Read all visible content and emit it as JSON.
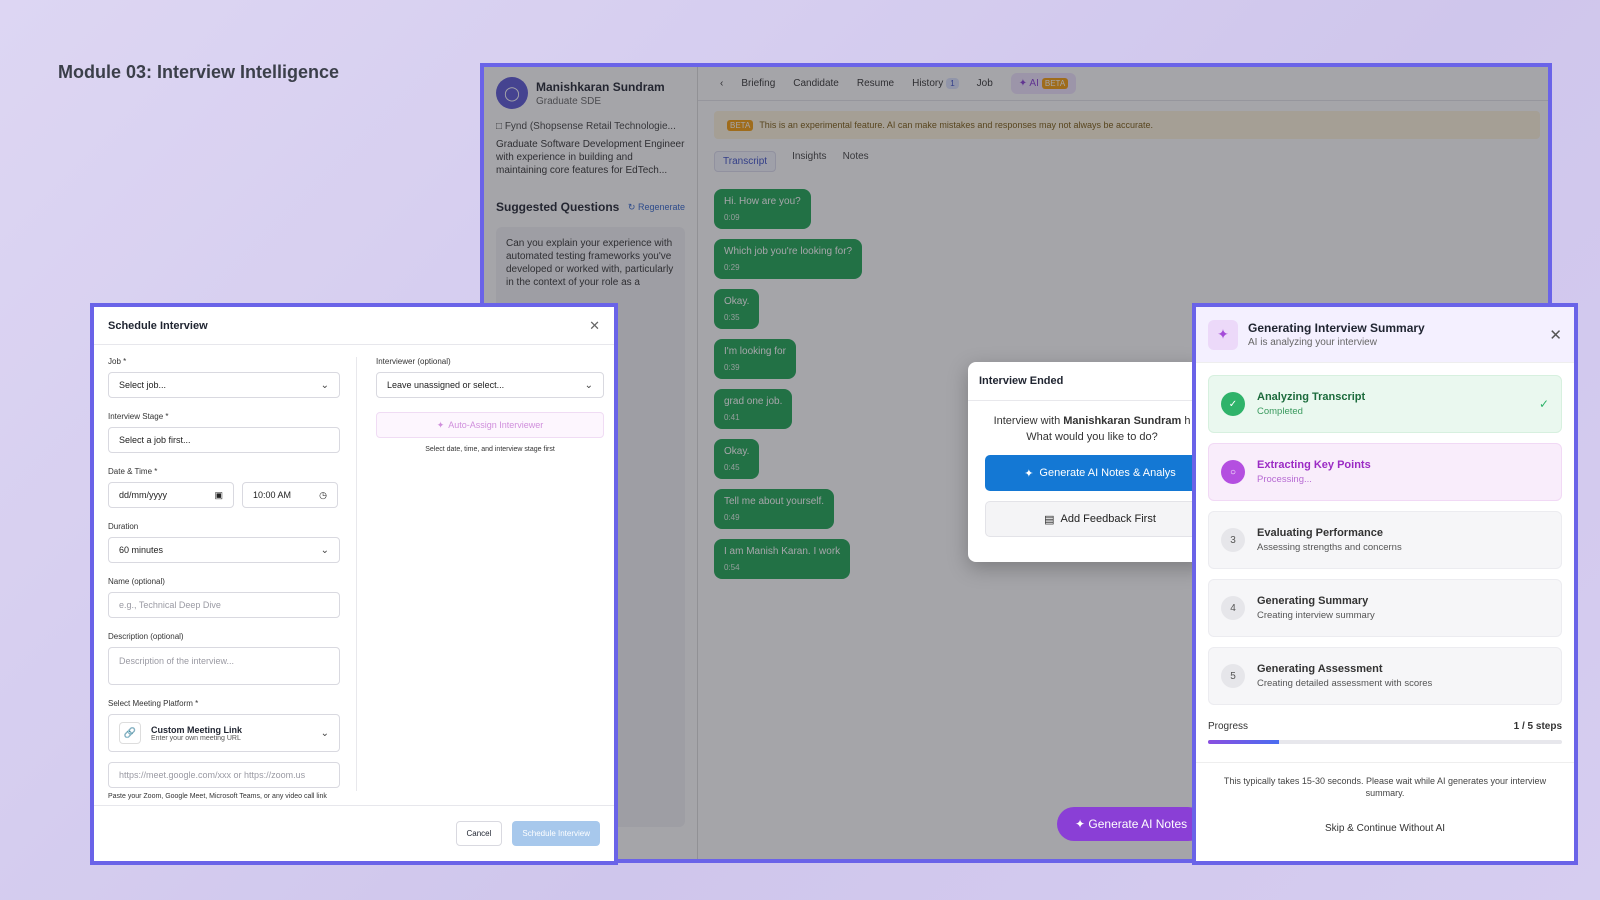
{
  "module_title": "Module 03: Interview Intelligence",
  "app": {
    "candidate": {
      "name": "Manishkaran Sundram",
      "role": "Graduate SDE",
      "company": "Fynd (Shopsense Retail Technologie...",
      "summary": "Graduate Software Development Engineer with experience in building and maintaining core features for EdTech..."
    },
    "suggested_questions_title": "Suggested Questions",
    "regenerate_label": "Regenerate",
    "question_text": "Can you explain your experience with automated testing frameworks you've developed or worked with, particularly in the context of your role as a",
    "tabs": [
      "Briefing",
      "Candidate",
      "Resume",
      "History",
      "Job",
      "AI"
    ],
    "history_count": "1",
    "beta_label": "BETA",
    "beta_notice": "This is an experimental feature. AI can make mistakes and responses may not always be accurate.",
    "sub_tabs": [
      "Transcript",
      "Insights",
      "Notes"
    ],
    "transcript": [
      {
        "text": "Hi. How are you?",
        "time": "0:09"
      },
      {
        "text": "Which job you're looking for?",
        "time": "0:29"
      },
      {
        "text": "Okay.",
        "time": "0:35"
      },
      {
        "text": "I'm looking for",
        "time": "0:39"
      },
      {
        "text": "grad one job.",
        "time": "0:41"
      },
      {
        "text": "Okay.",
        "time": "0:45"
      },
      {
        "text": "Tell me about yourself.",
        "time": "0:49"
      },
      {
        "text": "I am Manish Karan. I work",
        "time": "0:54"
      }
    ],
    "generate_float": "Generate  AI Notes"
  },
  "interview_ended": {
    "title": "Interview Ended",
    "message_prefix": "Interview with",
    "candidate": "Manishkaran Sundram",
    "message_suffix": "h",
    "question": "What would you like to do?",
    "generate_btn": "Generate AI Notes & Analys",
    "feedback_btn": "Add Feedback First"
  },
  "schedule": {
    "title": "Schedule Interview",
    "job_label": "Job *",
    "job_value": "Select job...",
    "stage_label": "Interview Stage *",
    "stage_value": "Select a job first...",
    "datetime_label": "Date & Time *",
    "date_placeholder": "dd/mm/yyyy",
    "time_value": "10:00 AM",
    "duration_label": "Duration",
    "duration_value": "60 minutes",
    "name_label": "Name (optional)",
    "name_placeholder": "e.g., Technical Deep Dive",
    "desc_label": "Description (optional)",
    "desc_placeholder": "Description of the interview...",
    "platform_label": "Select Meeting Platform *",
    "platform_name": "Custom Meeting Link",
    "platform_sub": "Enter your own meeting URL",
    "url_placeholder": "https://meet.google.com/xxx or https://zoom.us",
    "url_hint": "Paste your Zoom, Google Meet, Microsoft Teams, or any video call link",
    "interviewer_label": "Interviewer (optional)",
    "interviewer_value": "Leave unassigned or select...",
    "auto_assign": "Auto-Assign Interviewer",
    "auto_hint": "Select date, time, and interview stage first",
    "cancel": "Cancel",
    "submit": "Schedule Interview"
  },
  "summary_panel": {
    "title": "Generating Interview Summary",
    "subtitle": "AI is analyzing your interview",
    "steps": [
      {
        "num": "",
        "title": "Analyzing Transcript",
        "sub": "Completed",
        "state": "done"
      },
      {
        "num": "",
        "title": "Extracting Key Points",
        "sub": "Processing...",
        "state": "active"
      },
      {
        "num": "3",
        "title": "Evaluating Performance",
        "sub": "Assessing strengths and concerns",
        "state": "pending"
      },
      {
        "num": "4",
        "title": "Generating Summary",
        "sub": "Creating interview summary",
        "state": "pending"
      },
      {
        "num": "5",
        "title": "Generating Assessment",
        "sub": "Creating detailed assessment with scores",
        "state": "pending"
      }
    ],
    "progress_label": "Progress",
    "progress_text": "1 / 5 steps",
    "progress_fraction": 0.2,
    "note": "This typically takes 15-30 seconds. Please wait while AI generates your interview summary.",
    "skip": "Skip & Continue Without AI"
  }
}
